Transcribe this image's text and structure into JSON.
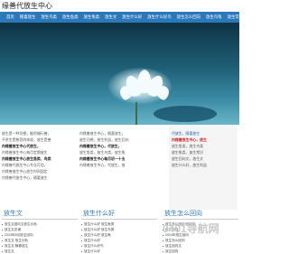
{
  "site": {
    "title": "缘善代放生中心"
  },
  "nav": [
    "首页",
    "随喜放生",
    "放生鸟类",
    "放生鱼类",
    "放生龟类",
    "放生文",
    "放生什么好",
    "放生什么好鸟",
    "放生怎么回向",
    "放生鸟龟",
    "放生常识"
  ],
  "intro_left": [
    "放生是一种功德，能积福行善，",
    "不杀生是慈悲的体现，放生是善",
    "内缘善放生中心代放生，",
    "内缘善放生中心每月定期放生",
    "内缘善放生中心放生鱼类、鸟类",
    "内缘善代放生中心专业可信，",
    "内缘善放生中心放生时间固定",
    "内缘善代放生中心，随喜放生"
  ],
  "intro_mid": [
    "内缘善放生中心，随喜放生，",
    "放生功德，放生利益，放生回向",
    "内缘善放生中心，代放生，",
    "放生鱼类，放生鸟类，放生龟",
    "内缘善放生中心每月初一十五",
    "内缘善放生中心，代放生，放"
  ],
  "intro_right": [
    "代放生，随喜放生",
    "内缘善放生中心，放生",
    "放生鱼类，放生鸟类",
    "放生龟类，放生常识",
    "放生回向文，放生文",
    "放生什么好，放生利益"
  ],
  "sections": [
    {
      "title": "放生文",
      "rows": [
        "放生文回向文放生仪轨",
        "放生文念诵",
        "2024年6月放生回向",
        "放生文 放生仪轨",
        "放生文 随喜放生",
        "放生文"
      ]
    },
    {
      "title": "放生什么好",
      "rows": [
        "放生什么好 放生鱼类",
        "放生什么好 放生鸟类",
        "放生什么好 放生龟",
        "放生什么好",
        "放生什么好鸟",
        "放生什么好"
      ]
    },
    {
      "title": "放生怎么回向",
      "rows": [
        "放生怎么回向 回向文",
        "放生回向",
        "2024年放生回向",
        "放生怎么回向",
        "放生回向文",
        "放生回向"
      ]
    }
  ],
  "watermark": "0401导航网"
}
